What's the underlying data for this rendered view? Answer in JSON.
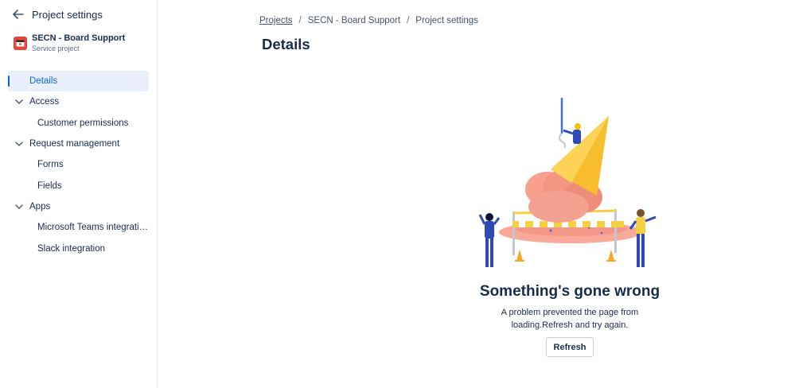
{
  "sidebar": {
    "header_title": "Project settings",
    "project": {
      "name": "SECN - Board Support",
      "type": "Service project"
    },
    "items": [
      {
        "label": "Details"
      },
      {
        "label": "Access"
      },
      {
        "label": "Customer permissions"
      },
      {
        "label": "Request management"
      },
      {
        "label": "Forms"
      },
      {
        "label": "Fields"
      },
      {
        "label": "Apps"
      },
      {
        "label": "Microsoft Teams integration"
      },
      {
        "label": "Slack integration"
      }
    ]
  },
  "breadcrumb": [
    "Projects",
    "SECN - Board Support",
    "Project settings"
  ],
  "page": {
    "title": "Details"
  },
  "error": {
    "title": "Something's gone wrong",
    "message": "A problem prevented the page from loading.Refresh and try again.",
    "refresh_label": "Refresh"
  },
  "colors": {
    "accent": "#0c66e4",
    "active_bg": "#e9f0fc",
    "project_icon": "#e2483d"
  },
  "icons": {
    "back": "arrow-left-icon",
    "group": "chevron-down-icon",
    "project": "project-avatar-icon",
    "illustration": "broken-ice-cream-illustration"
  }
}
